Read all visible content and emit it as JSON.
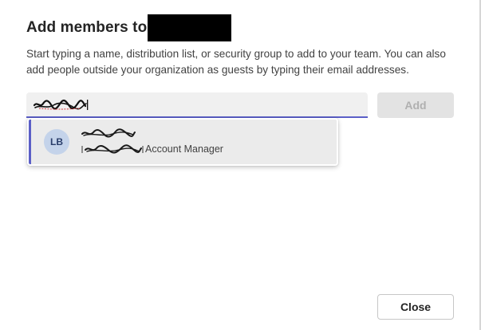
{
  "dialog": {
    "title": "Add members to",
    "description": "Start typing a name, distribution list, or security group to add to your team. You can also add people outside your organization as guests by typing their email addresses."
  },
  "search": {
    "value": "",
    "placeholder": ""
  },
  "add_button": {
    "label": "Add",
    "enabled": false
  },
  "suggestions": [
    {
      "initials": "LB",
      "role": "Account Manager"
    }
  ],
  "close_button": {
    "label": "Close"
  },
  "colors": {
    "accent": "#5b5fc7",
    "avatar_bg": "#c4d3ea",
    "suggestion_highlight": "#ebebeb",
    "disabled_button_bg": "#e3e3e3"
  },
  "icons": {
    "redaction": "black-redaction-box"
  }
}
